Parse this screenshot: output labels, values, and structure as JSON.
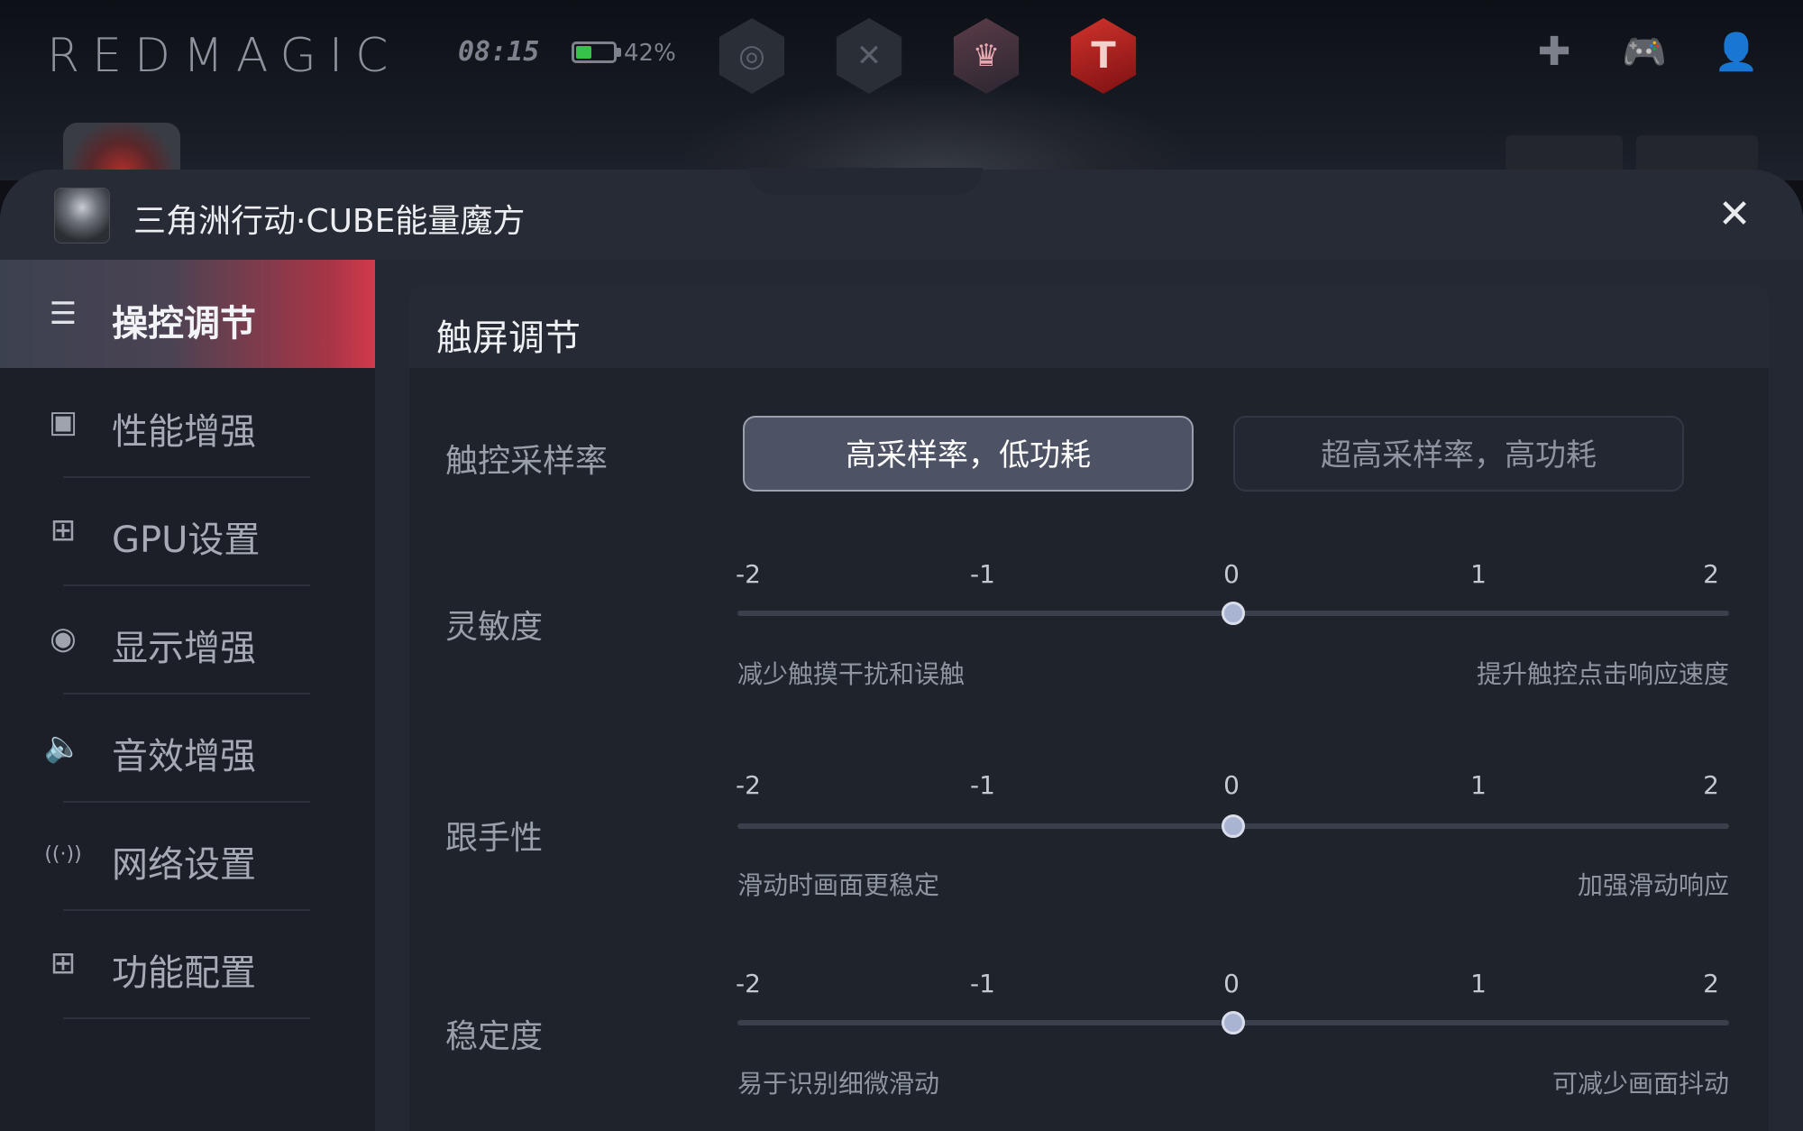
{
  "status_bar": {
    "brand": "REDMAGIC",
    "time": "08:15",
    "battery_percent_label": "42%",
    "battery_level": 0.42
  },
  "top_apps": [
    {
      "name": "speed-dial-icon",
      "glyph": "◎"
    },
    {
      "name": "crossed-swords-icon",
      "glyph": "✕"
    },
    {
      "name": "anime-character-icon",
      "glyph": "♛"
    },
    {
      "name": "red-t-logo-icon",
      "glyph": "T"
    }
  ],
  "top_right_icons": [
    {
      "name": "dpad-icon",
      "glyph": "✚"
    },
    {
      "name": "gamepad-icon",
      "glyph": "🎮"
    },
    {
      "name": "user-icon",
      "glyph": "👤"
    }
  ],
  "header": {
    "game_title": "三角洲行动·CUBE能量魔方",
    "close_glyph": "✕"
  },
  "sidebar": {
    "items": [
      {
        "label": "操控调节",
        "icon": "sliders-icon",
        "glyph": "☰",
        "active": true
      },
      {
        "label": "性能增强",
        "icon": "cpu-icon",
        "glyph": "▣",
        "active": false
      },
      {
        "label": "GPU设置",
        "icon": "chip-icon",
        "glyph": "⊞",
        "active": false
      },
      {
        "label": "显示增强",
        "icon": "eye-icon",
        "glyph": "◉",
        "active": false
      },
      {
        "label": "音效增强",
        "icon": "speaker-icon",
        "glyph": "🔈",
        "active": false
      },
      {
        "label": "网络设置",
        "icon": "wifi-icon",
        "glyph": "((·))",
        "active": false
      },
      {
        "label": "功能配置",
        "icon": "grid-icon",
        "glyph": "⊞",
        "active": false
      }
    ]
  },
  "content": {
    "title": "触屏调节",
    "sampling": {
      "label": "触控采样率",
      "options": [
        "高采样率，低功耗",
        "超高采样率，高功耗"
      ],
      "selected_index": 0
    },
    "sliders": [
      {
        "label": "灵敏度",
        "ticks": [
          "-2",
          "-1",
          "0",
          "1",
          "2"
        ],
        "value": 0,
        "min": -2,
        "max": 2,
        "hint_left": "减少触摸干扰和误触",
        "hint_right": "提升触控点击响应速度"
      },
      {
        "label": "跟手性",
        "ticks": [
          "-2",
          "-1",
          "0",
          "1",
          "2"
        ],
        "value": 0,
        "min": -2,
        "max": 2,
        "hint_left": "滑动时画面更稳定",
        "hint_right": "加强滑动响应"
      },
      {
        "label": "稳定度",
        "ticks": [
          "-2",
          "-1",
          "0",
          "1",
          "2"
        ],
        "value": 0,
        "min": -2,
        "max": 2,
        "hint_left": "易于识别细微滑动",
        "hint_right": "可减少画面抖动"
      }
    ]
  }
}
